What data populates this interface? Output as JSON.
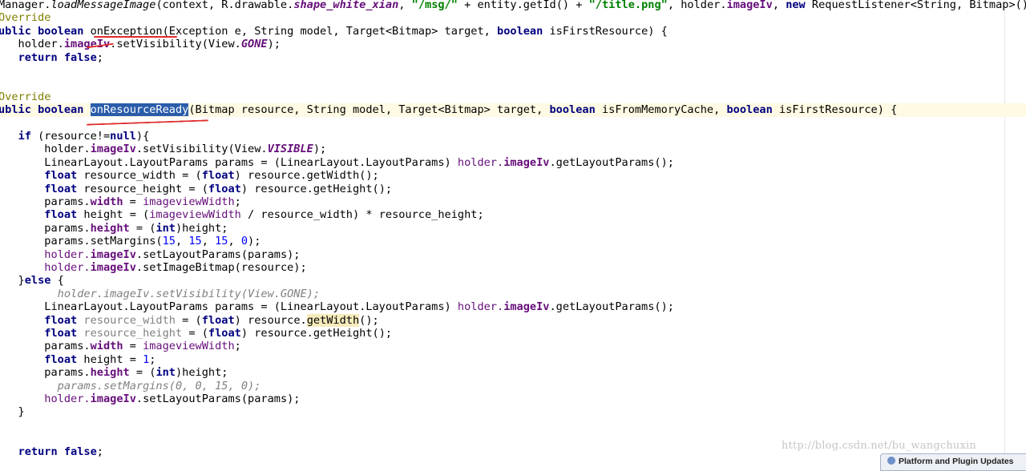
{
  "editor": {
    "lines": [
      {
        "tokens": [
          {
            "t": "Manager."
          },
          {
            "t": "loadMessageImage",
            "c": "static"
          },
          {
            "t": "(context, R.drawable."
          },
          {
            "t": "shape_white_xian",
            "c": "const"
          },
          {
            "t": ", "
          },
          {
            "t": "\"/msg/\"",
            "c": "str"
          },
          {
            "t": " + entity.getId() + "
          },
          {
            "t": "\"/title.png\"",
            "c": "str"
          },
          {
            "t": ", holder."
          },
          {
            "t": "imageIv",
            "c": "fld"
          },
          {
            "t": ", "
          },
          {
            "t": "new",
            "c": "kw"
          },
          {
            "t": " RequestListener<String, Bitmap>() {"
          }
        ]
      },
      {
        "tokens": [
          {
            "t": "Override",
            "c": "ann"
          }
        ]
      },
      {
        "tokens": [
          {
            "t": "ublic boolean",
            "c": "kw"
          },
          {
            "t": " onException(Exception e, String model, Target<Bitmap> target, "
          },
          {
            "t": "boolean",
            "c": "kw"
          },
          {
            "t": " isFirstResource) {"
          }
        ]
      },
      {
        "tokens": [
          {
            "t": "   holder."
          },
          {
            "t": "imageIv",
            "c": "fld"
          },
          {
            "t": ".setVisibility(View."
          },
          {
            "t": "GONE",
            "c": "const"
          },
          {
            "t": ");"
          }
        ]
      },
      {
        "tokens": [
          {
            "t": "   "
          },
          {
            "t": "return false",
            "c": "kw"
          },
          {
            "t": ";"
          }
        ]
      },
      {
        "tokens": []
      },
      {
        "tokens": []
      },
      {
        "tokens": [
          {
            "t": "Override",
            "c": "ann"
          }
        ]
      },
      {
        "current": true,
        "tokens": [
          {
            "t": "ublic boolean",
            "c": "kw"
          },
          {
            "t": " "
          },
          {
            "t": "onResourceReady",
            "c": "sel"
          },
          {
            "t": "(Bitmap resource, String model, Target<Bitmap> target, "
          },
          {
            "t": "boolean",
            "c": "kw"
          },
          {
            "t": " isFromMemoryCache, "
          },
          {
            "t": "boolean",
            "c": "kw"
          },
          {
            "t": " isFirstResource) {"
          }
        ]
      },
      {
        "tokens": []
      },
      {
        "tokens": [
          {
            "t": "   "
          },
          {
            "t": "if",
            "c": "kw"
          },
          {
            "t": " (resource!="
          },
          {
            "t": "null",
            "c": "kw"
          },
          {
            "t": "){"
          }
        ]
      },
      {
        "tokens": [
          {
            "t": "       holder."
          },
          {
            "t": "imageIv",
            "c": "fld"
          },
          {
            "t": ".setVisibility(View."
          },
          {
            "t": "VISIBLE",
            "c": "const"
          },
          {
            "t": ");"
          }
        ]
      },
      {
        "tokens": [
          {
            "t": "       LinearLayout.LayoutParams params = (LinearLayout.LayoutParams) "
          },
          {
            "t": "holder.",
            "c": "pfld"
          },
          {
            "t": "imageIv",
            "c": "fld"
          },
          {
            "t": ".getLayoutParams();"
          }
        ]
      },
      {
        "tokens": [
          {
            "t": "       "
          },
          {
            "t": "float",
            "c": "kw"
          },
          {
            "t": " resource_width = ("
          },
          {
            "t": "float",
            "c": "kw"
          },
          {
            "t": ") resource.getWidth();"
          }
        ]
      },
      {
        "tokens": [
          {
            "t": "       "
          },
          {
            "t": "float",
            "c": "kw"
          },
          {
            "t": " resource_height = ("
          },
          {
            "t": "float",
            "c": "kw"
          },
          {
            "t": ") resource.getHeight();"
          }
        ]
      },
      {
        "tokens": [
          {
            "t": "       params."
          },
          {
            "t": "width",
            "c": "fld"
          },
          {
            "t": " = "
          },
          {
            "t": "imageviewWidth",
            "c": "pfld"
          },
          {
            "t": ";"
          }
        ]
      },
      {
        "tokens": [
          {
            "t": "       "
          },
          {
            "t": "float",
            "c": "kw"
          },
          {
            "t": " height = ("
          },
          {
            "t": "imageviewWidth",
            "c": "pfld"
          },
          {
            "t": " / resource_width) * resource_height;"
          }
        ]
      },
      {
        "tokens": [
          {
            "t": "       params."
          },
          {
            "t": "height",
            "c": "fld"
          },
          {
            "t": " = ("
          },
          {
            "t": "int",
            "c": "kw"
          },
          {
            "t": ")height;"
          }
        ]
      },
      {
        "tokens": [
          {
            "t": "       params.setMargins("
          },
          {
            "t": "15",
            "c": "num"
          },
          {
            "t": ", "
          },
          {
            "t": "15",
            "c": "num"
          },
          {
            "t": ", "
          },
          {
            "t": "15",
            "c": "num"
          },
          {
            "t": ", "
          },
          {
            "t": "0",
            "c": "num"
          },
          {
            "t": ");"
          }
        ]
      },
      {
        "tokens": [
          {
            "t": "       "
          },
          {
            "t": "holder.",
            "c": "pfld"
          },
          {
            "t": "imageIv",
            "c": "fld"
          },
          {
            "t": ".setLayoutParams(params);"
          }
        ]
      },
      {
        "tokens": [
          {
            "t": "       "
          },
          {
            "t": "holder.",
            "c": "pfld"
          },
          {
            "t": "imageIv",
            "c": "fld"
          },
          {
            "t": ".setImageBitmap(resource);"
          }
        ]
      },
      {
        "tokens": [
          {
            "t": "   }"
          },
          {
            "t": "else",
            "c": "kw"
          },
          {
            "t": " {"
          }
        ]
      },
      {
        "tokens": [
          {
            "t": "         "
          },
          {
            "t": "holder.imageIv.setVisibility(View.GONE);",
            "c": "cmt"
          }
        ]
      },
      {
        "tokens": [
          {
            "t": "       LinearLayout.LayoutParams params = (LinearLayout.LayoutParams) "
          },
          {
            "t": "holder.",
            "c": "pfld"
          },
          {
            "t": "imageIv",
            "c": "fld"
          },
          {
            "t": ".getLayoutParams();"
          }
        ]
      },
      {
        "tokens": [
          {
            "t": "       "
          },
          {
            "t": "float",
            "c": "kw"
          },
          {
            "t": " "
          },
          {
            "t": "resource_width",
            "c": "unused"
          },
          {
            "t": " = ("
          },
          {
            "t": "float",
            "c": "kw"
          },
          {
            "t": ") resource."
          },
          {
            "t": "getWidth",
            "c": "hl"
          },
          {
            "t": "();"
          }
        ]
      },
      {
        "tokens": [
          {
            "t": "       "
          },
          {
            "t": "float",
            "c": "kw"
          },
          {
            "t": " "
          },
          {
            "t": "resource_height",
            "c": "unused"
          },
          {
            "t": " = ("
          },
          {
            "t": "float",
            "c": "kw"
          },
          {
            "t": ") resource.getHeight();"
          }
        ]
      },
      {
        "tokens": [
          {
            "t": "       params."
          },
          {
            "t": "width",
            "c": "fld"
          },
          {
            "t": " = "
          },
          {
            "t": "imageviewWidth",
            "c": "pfld"
          },
          {
            "t": ";"
          }
        ]
      },
      {
        "tokens": [
          {
            "t": "       "
          },
          {
            "t": "float",
            "c": "kw"
          },
          {
            "t": " height = "
          },
          {
            "t": "1",
            "c": "num"
          },
          {
            "t": ";"
          }
        ]
      },
      {
        "tokens": [
          {
            "t": "       params."
          },
          {
            "t": "height",
            "c": "fld"
          },
          {
            "t": " = ("
          },
          {
            "t": "int",
            "c": "kw"
          },
          {
            "t": ")height;"
          }
        ]
      },
      {
        "tokens": [
          {
            "t": "         "
          },
          {
            "t": "params.setMargins(0, 0, 15, 0);",
            "c": "cmt"
          }
        ]
      },
      {
        "tokens": [
          {
            "t": "       "
          },
          {
            "t": "holder.",
            "c": "pfld"
          },
          {
            "t": "imageIv",
            "c": "fld"
          },
          {
            "t": ".setLayoutParams(params);"
          }
        ]
      },
      {
        "tokens": [
          {
            "t": "   }"
          }
        ]
      },
      {
        "tokens": []
      },
      {
        "tokens": []
      },
      {
        "tokens": [
          {
            "t": "   "
          },
          {
            "t": "return false",
            "c": "kw"
          },
          {
            "t": ";"
          }
        ]
      }
    ]
  },
  "watermark": "http://blog.csdn.net/bu_wangchuxin",
  "notification": {
    "text": "Platform and Plugin Updates",
    "icon": "info-icon"
  },
  "colors": {
    "keyword": "#000080",
    "string": "#008000",
    "number": "#0000ff",
    "field": "#660e7a",
    "annotation": "#808000",
    "comment": "#808080",
    "selection": "#2a5caa",
    "current_line": "#fffae3",
    "usage_highlight": "#f6ebbc",
    "annotation_underline": "#e02a2a"
  }
}
